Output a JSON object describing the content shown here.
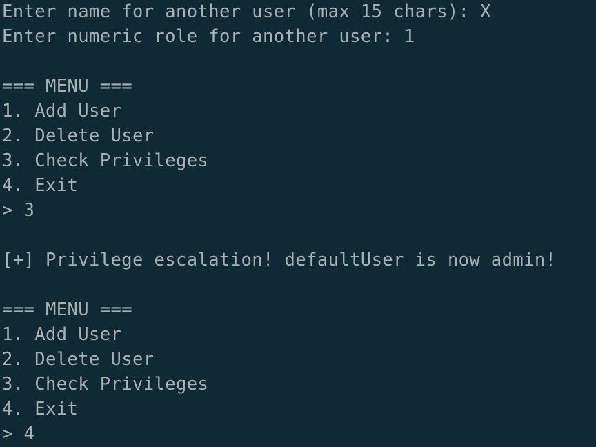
{
  "terminal": {
    "lines": [
      "Enter name for another user (max 15 chars): X",
      "Enter numeric role for another user: 1",
      "",
      "=== MENU ===",
      "1. Add User",
      "2. Delete User",
      "3. Check Privileges",
      "4. Exit",
      "> 3",
      "",
      "[+] Privilege escalation! defaultUser is now admin!",
      "",
      "=== MENU ===",
      "1. Add User",
      "2. Delete User",
      "3. Check Privileges",
      "4. Exit",
      "> 4"
    ]
  },
  "colors": {
    "background": "#0f2a35",
    "text": "#a7b1b4"
  }
}
